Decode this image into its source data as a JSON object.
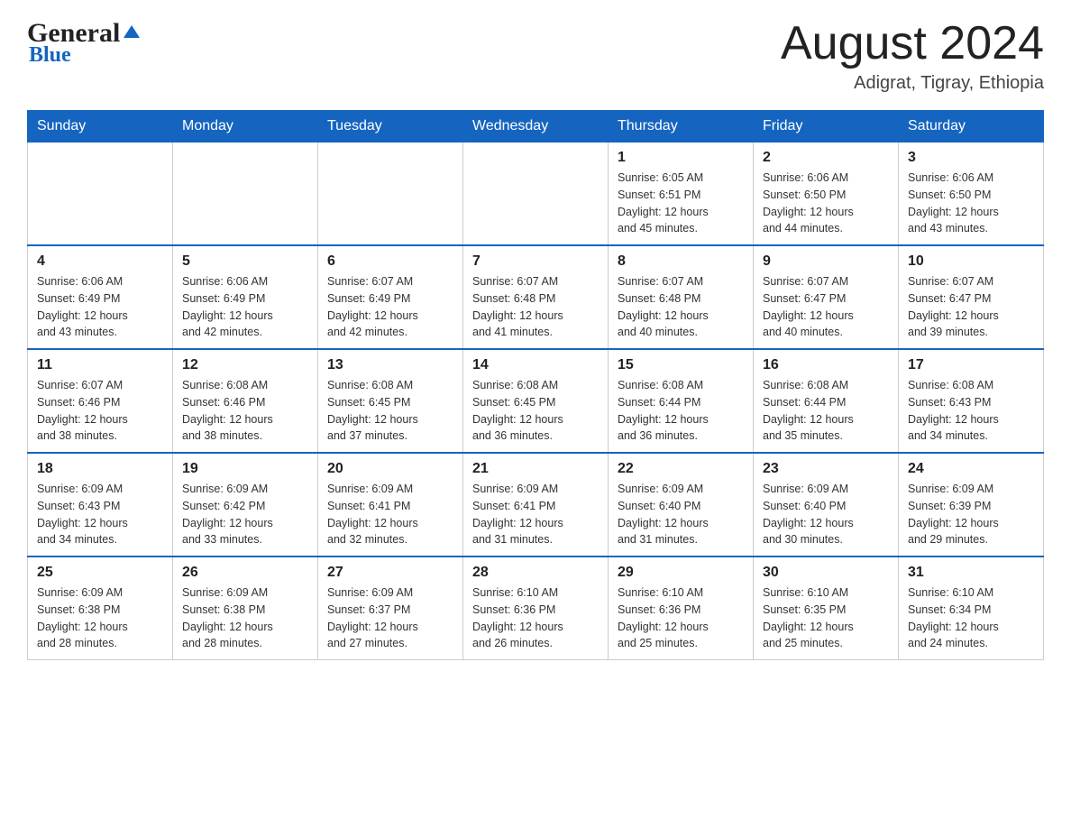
{
  "header": {
    "logo_general": "General",
    "logo_blue": "Blue",
    "month_year": "August 2024",
    "location": "Adigrat, Tigray, Ethiopia"
  },
  "weekdays": [
    "Sunday",
    "Monday",
    "Tuesday",
    "Wednesday",
    "Thursday",
    "Friday",
    "Saturday"
  ],
  "weeks": [
    [
      {
        "day": "",
        "info": ""
      },
      {
        "day": "",
        "info": ""
      },
      {
        "day": "",
        "info": ""
      },
      {
        "day": "",
        "info": ""
      },
      {
        "day": "1",
        "info": "Sunrise: 6:05 AM\nSunset: 6:51 PM\nDaylight: 12 hours\nand 45 minutes."
      },
      {
        "day": "2",
        "info": "Sunrise: 6:06 AM\nSunset: 6:50 PM\nDaylight: 12 hours\nand 44 minutes."
      },
      {
        "day": "3",
        "info": "Sunrise: 6:06 AM\nSunset: 6:50 PM\nDaylight: 12 hours\nand 43 minutes."
      }
    ],
    [
      {
        "day": "4",
        "info": "Sunrise: 6:06 AM\nSunset: 6:49 PM\nDaylight: 12 hours\nand 43 minutes."
      },
      {
        "day": "5",
        "info": "Sunrise: 6:06 AM\nSunset: 6:49 PM\nDaylight: 12 hours\nand 42 minutes."
      },
      {
        "day": "6",
        "info": "Sunrise: 6:07 AM\nSunset: 6:49 PM\nDaylight: 12 hours\nand 42 minutes."
      },
      {
        "day": "7",
        "info": "Sunrise: 6:07 AM\nSunset: 6:48 PM\nDaylight: 12 hours\nand 41 minutes."
      },
      {
        "day": "8",
        "info": "Sunrise: 6:07 AM\nSunset: 6:48 PM\nDaylight: 12 hours\nand 40 minutes."
      },
      {
        "day": "9",
        "info": "Sunrise: 6:07 AM\nSunset: 6:47 PM\nDaylight: 12 hours\nand 40 minutes."
      },
      {
        "day": "10",
        "info": "Sunrise: 6:07 AM\nSunset: 6:47 PM\nDaylight: 12 hours\nand 39 minutes."
      }
    ],
    [
      {
        "day": "11",
        "info": "Sunrise: 6:07 AM\nSunset: 6:46 PM\nDaylight: 12 hours\nand 38 minutes."
      },
      {
        "day": "12",
        "info": "Sunrise: 6:08 AM\nSunset: 6:46 PM\nDaylight: 12 hours\nand 38 minutes."
      },
      {
        "day": "13",
        "info": "Sunrise: 6:08 AM\nSunset: 6:45 PM\nDaylight: 12 hours\nand 37 minutes."
      },
      {
        "day": "14",
        "info": "Sunrise: 6:08 AM\nSunset: 6:45 PM\nDaylight: 12 hours\nand 36 minutes."
      },
      {
        "day": "15",
        "info": "Sunrise: 6:08 AM\nSunset: 6:44 PM\nDaylight: 12 hours\nand 36 minutes."
      },
      {
        "day": "16",
        "info": "Sunrise: 6:08 AM\nSunset: 6:44 PM\nDaylight: 12 hours\nand 35 minutes."
      },
      {
        "day": "17",
        "info": "Sunrise: 6:08 AM\nSunset: 6:43 PM\nDaylight: 12 hours\nand 34 minutes."
      }
    ],
    [
      {
        "day": "18",
        "info": "Sunrise: 6:09 AM\nSunset: 6:43 PM\nDaylight: 12 hours\nand 34 minutes."
      },
      {
        "day": "19",
        "info": "Sunrise: 6:09 AM\nSunset: 6:42 PM\nDaylight: 12 hours\nand 33 minutes."
      },
      {
        "day": "20",
        "info": "Sunrise: 6:09 AM\nSunset: 6:41 PM\nDaylight: 12 hours\nand 32 minutes."
      },
      {
        "day": "21",
        "info": "Sunrise: 6:09 AM\nSunset: 6:41 PM\nDaylight: 12 hours\nand 31 minutes."
      },
      {
        "day": "22",
        "info": "Sunrise: 6:09 AM\nSunset: 6:40 PM\nDaylight: 12 hours\nand 31 minutes."
      },
      {
        "day": "23",
        "info": "Sunrise: 6:09 AM\nSunset: 6:40 PM\nDaylight: 12 hours\nand 30 minutes."
      },
      {
        "day": "24",
        "info": "Sunrise: 6:09 AM\nSunset: 6:39 PM\nDaylight: 12 hours\nand 29 minutes."
      }
    ],
    [
      {
        "day": "25",
        "info": "Sunrise: 6:09 AM\nSunset: 6:38 PM\nDaylight: 12 hours\nand 28 minutes."
      },
      {
        "day": "26",
        "info": "Sunrise: 6:09 AM\nSunset: 6:38 PM\nDaylight: 12 hours\nand 28 minutes."
      },
      {
        "day": "27",
        "info": "Sunrise: 6:09 AM\nSunset: 6:37 PM\nDaylight: 12 hours\nand 27 minutes."
      },
      {
        "day": "28",
        "info": "Sunrise: 6:10 AM\nSunset: 6:36 PM\nDaylight: 12 hours\nand 26 minutes."
      },
      {
        "day": "29",
        "info": "Sunrise: 6:10 AM\nSunset: 6:36 PM\nDaylight: 12 hours\nand 25 minutes."
      },
      {
        "day": "30",
        "info": "Sunrise: 6:10 AM\nSunset: 6:35 PM\nDaylight: 12 hours\nand 25 minutes."
      },
      {
        "day": "31",
        "info": "Sunrise: 6:10 AM\nSunset: 6:34 PM\nDaylight: 12 hours\nand 24 minutes."
      }
    ]
  ]
}
